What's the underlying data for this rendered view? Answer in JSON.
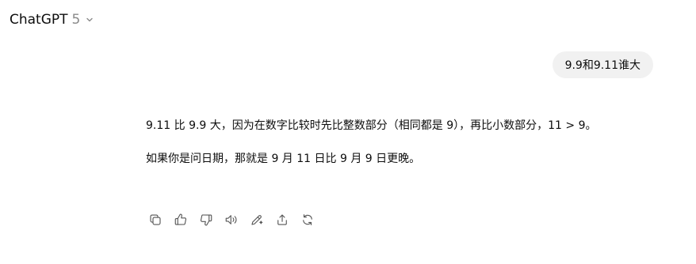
{
  "header": {
    "model_name": "ChatGPT",
    "model_version": "5",
    "dropdown_icon": "chevron-down-icon"
  },
  "conversation": {
    "user_message": "9.9和9.11谁大",
    "assistant_paragraphs": [
      "9.11 比 9.9 大，因为在数字比较时先比整数部分（相同都是 9），再比小数部分，11 > 9。",
      "如果你是问日期，那就是 9 月 11 日比 9 月 9 日更晚。"
    ]
  },
  "actions": {
    "icons": [
      "copy-icon",
      "thumbs-up-icon",
      "thumbs-down-icon",
      "read-aloud-icon",
      "edit-icon",
      "share-icon",
      "regenerate-icon"
    ]
  },
  "colors": {
    "user_bubble_bg": "#f1f1f1",
    "icon_stroke": "#555555",
    "muted_text": "#8a8a8a"
  }
}
